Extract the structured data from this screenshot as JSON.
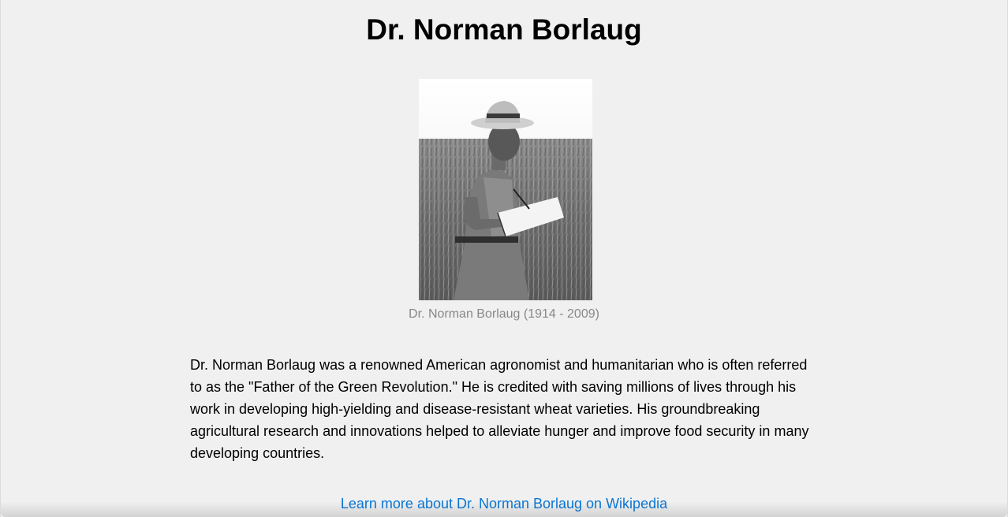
{
  "page": {
    "title": "Dr. Norman Borlaug"
  },
  "figure": {
    "caption": "Dr. Norman Borlaug (1914 - 2009)"
  },
  "bio": {
    "text": "Dr. Norman Borlaug was a renowned American agronomist and humanitarian who is often referred to as the \"Father of the Green Revolution.\" He is credited with saving millions of lives through his work in developing high-yielding and disease-resistant wheat varieties. His groundbreaking agricultural research and innovations helped to alleviate hunger and improve food security in many developing countries."
  },
  "links": {
    "wikipedia": "Learn more about Dr. Norman Borlaug on Wikipedia"
  },
  "colors": {
    "background": "#f0f0f0",
    "link": "#0a78d6",
    "caption": "#888888"
  }
}
